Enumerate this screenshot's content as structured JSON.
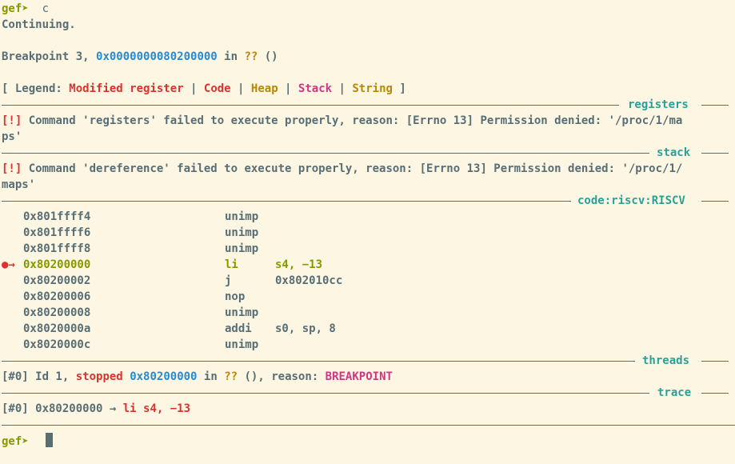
{
  "prompt": {
    "label": "gef➤",
    "command": "c"
  },
  "lines": {
    "continuing": "Continuing.",
    "breakpoint_prefix": "Breakpoint 3, ",
    "breakpoint_addr": "0x0000000080200000",
    "breakpoint_in": " in ",
    "breakpoint_func": "??",
    "breakpoint_args": " ()"
  },
  "legend": {
    "open": "[ Legend: ",
    "modified_register": "Modified register",
    "sep": " | ",
    "code": "Code",
    "heap": "Heap",
    "stack": "Stack",
    "string": "String",
    "close": " ]"
  },
  "sections": {
    "registers": "registers",
    "stack": "stack",
    "code": "code:riscv:RISCV",
    "threads": "threads",
    "trace": "trace"
  },
  "errors": {
    "tag": "[!]",
    "registers_line1": " Command 'registers' failed to execute properly, reason: [Errno 13] Permission denied: '/proc/1/ma",
    "registers_line2": "ps'",
    "dereference_line1": " Command 'dereference' failed to execute properly, reason: [Errno 13] Permission denied: '/proc/1/",
    "dereference_line2": "maps'"
  },
  "code_rows": [
    {
      "addr": "0x801ffff4",
      "mnemonic": "unimp",
      "operands": "",
      "current": false
    },
    {
      "addr": "0x801ffff6",
      "mnemonic": "unimp",
      "operands": "",
      "current": false
    },
    {
      "addr": "0x801ffff8",
      "mnemonic": "unimp",
      "operands": "",
      "current": false
    },
    {
      "addr": "0x80200000",
      "mnemonic": "li",
      "operands": "s4, −13",
      "current": true
    },
    {
      "addr": "0x80200002",
      "mnemonic": "j",
      "operands": "0x802010cc",
      "current": false
    },
    {
      "addr": "0x80200006",
      "mnemonic": "nop",
      "operands": "",
      "current": false
    },
    {
      "addr": "0x80200008",
      "mnemonic": "unimp",
      "operands": "",
      "current": false
    },
    {
      "addr": "0x8020000a",
      "mnemonic": "addi",
      "operands": "s0, sp, 8",
      "current": false
    },
    {
      "addr": "0x8020000c",
      "mnemonic": "unimp",
      "operands": "",
      "current": false
    }
  ],
  "current_marker": "●→",
  "threads": {
    "id": "[#0]",
    "text1": " Id 1, ",
    "stopped": "stopped",
    "addr": "0x80200000",
    "in": " in ",
    "func": "??",
    "text2": " (), reason: ",
    "reason": "BREAKPOINT"
  },
  "trace": {
    "id": "[#0]",
    "addr": " 0x80200000 → ",
    "insn": "li s4, −13"
  },
  "colors": {
    "background": "#fdf6e3",
    "text": "#586e75",
    "olive": "#859900",
    "blue": "#268bd2",
    "yellow": "#b58900",
    "red": "#dc322f",
    "magenta": "#d33682",
    "cyan": "#2aa198"
  }
}
